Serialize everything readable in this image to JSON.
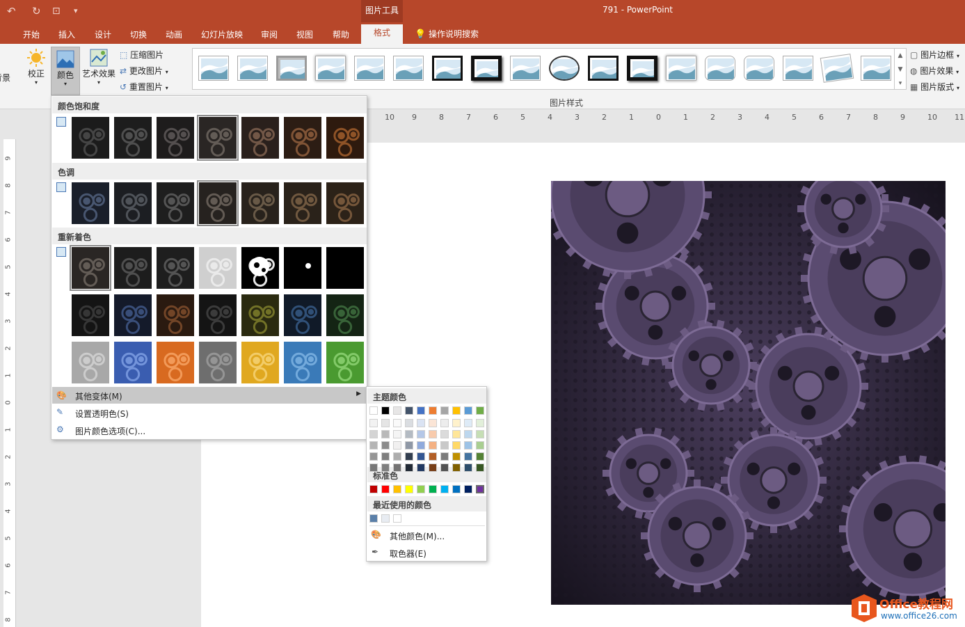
{
  "app": {
    "window_title": "791  -  PowerPoint",
    "tools_context": "图片工具"
  },
  "tabs": [
    {
      "label": "开始"
    },
    {
      "label": "插入"
    },
    {
      "label": "设计"
    },
    {
      "label": "切换"
    },
    {
      "label": "动画"
    },
    {
      "label": "幻灯片放映"
    },
    {
      "label": "审阅"
    },
    {
      "label": "视图"
    },
    {
      "label": "帮助"
    },
    {
      "label": "格式"
    }
  ],
  "tell_me": "操作说明搜索",
  "ribbon": {
    "remove_bg_partial": "背景",
    "corrections": "校正",
    "color": "颜色",
    "artistic": "艺术效果",
    "compress": "压缩图片",
    "change": "更改图片",
    "reset": "重置图片",
    "styles_group": "图片样式",
    "border": "图片边框",
    "effects": "图片效果",
    "layout": "图片版式"
  },
  "ruler_labels": [
    "10",
    "9",
    "8",
    "7",
    "6",
    "5",
    "4",
    "3",
    "2",
    "1",
    "0",
    "1",
    "2",
    "3",
    "4",
    "5",
    "6",
    "7",
    "8",
    "9",
    "10",
    "11"
  ],
  "vruler_labels": [
    "9",
    "8",
    "7",
    "6",
    "5",
    "4",
    "3",
    "2",
    "1",
    "0",
    "1",
    "2",
    "3",
    "4",
    "5",
    "6",
    "7",
    "8"
  ],
  "color_menu": {
    "saturation_title": "颜色饱和度",
    "tone_title": "色调",
    "recolor_title": "重新着色",
    "more_variations": "其他变体(M)",
    "set_transparent": "设置透明色(S)",
    "color_options": "图片颜色选项(C)..."
  },
  "submenu": {
    "theme_title": "主题颜色",
    "standard_title": "标准色",
    "recent_title": "最近使用的颜色",
    "more_colors": "其他颜色(M)...",
    "eyedropper": "取色器(E)",
    "theme_colors": [
      "#ffffff",
      "#000000",
      "#e7e6e6",
      "#44546a",
      "#4472c4",
      "#ed7d31",
      "#a5a5a5",
      "#ffc000",
      "#5b9bd5",
      "#70ad47"
    ],
    "standard_colors": [
      "#c00000",
      "#ff0000",
      "#ffc000",
      "#ffff00",
      "#92d050",
      "#00b050",
      "#00b0f0",
      "#0070c0",
      "#002060",
      "#7030a0"
    ],
    "recent_colors": [
      "#5a7fa8",
      "#e8ecf2",
      "#ffffff"
    ]
  },
  "watermark": {
    "brand": "Office教程网",
    "url": "www.office26.com"
  }
}
